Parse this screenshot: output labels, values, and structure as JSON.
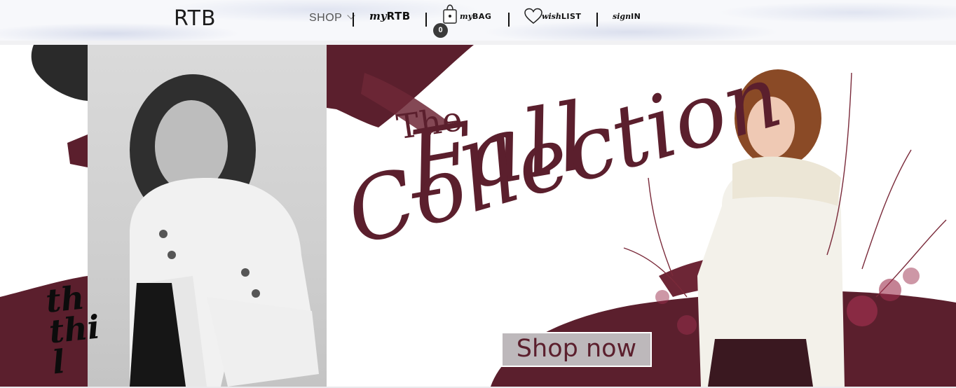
{
  "header": {
    "logo": "RTB",
    "shop_label": "SHOP",
    "my_rtb": {
      "script": "my",
      "caps": "RTB"
    },
    "my_bag": {
      "script": "my",
      "caps": "BAG",
      "count": "0"
    },
    "wish_list": {
      "script": "wish",
      "caps": "LIST"
    },
    "sign_in": {
      "script": "sign",
      "caps": "IN"
    }
  },
  "hero": {
    "the": "The",
    "fall": "Fall",
    "collection": "Collection",
    "cta_label": "Shop now",
    "left_script_lines": [
      "th",
      "thi",
      "l"
    ]
  },
  "colors": {
    "accent": "#5b1f2d",
    "button_bg": "#bdb8bb",
    "badge_bg": "#3a3a3a"
  },
  "icons": [
    "chevron-down-icon",
    "shopping-bag-icon",
    "heart-icon"
  ]
}
